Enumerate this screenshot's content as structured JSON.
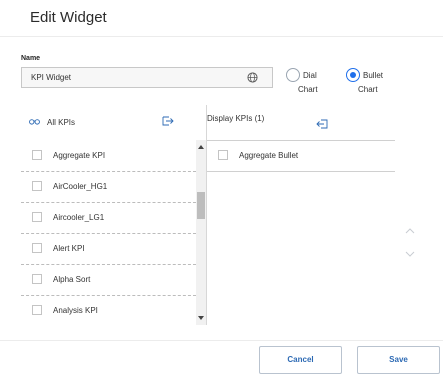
{
  "dialog": {
    "title": "Edit Widget"
  },
  "name_field": {
    "label": "Name",
    "value": "KPI Widget"
  },
  "chart_type": {
    "options": [
      {
        "line1": "Dial",
        "line2": "Chart",
        "selected": false
      },
      {
        "line1": "Bullet",
        "line2": "Chart",
        "selected": true
      }
    ]
  },
  "left_pane": {
    "header": "All KPIs",
    "items": [
      "Aggregate KPI",
      "AirCooler_HG1",
      "Aircooler_LG1",
      "Alert KPI",
      "Alpha Sort",
      "Analysis KPI"
    ]
  },
  "right_pane": {
    "header": "Display KPIs (1)",
    "items": [
      "Aggregate Bullet"
    ]
  },
  "footer": {
    "cancel_label": "Cancel",
    "save_label": "Save"
  },
  "colors": {
    "accent": "#1f6feb",
    "icon": "#2d6ab4",
    "button_text": "#2d6ab4"
  },
  "icons": {
    "search": "binoculars-icon",
    "add_to_display": "arrow-right-icon",
    "remove_from_display": "arrow-left-icon",
    "globe": "globe-icon",
    "move_up": "chevron-up-icon",
    "move_down": "chevron-down-icon"
  }
}
